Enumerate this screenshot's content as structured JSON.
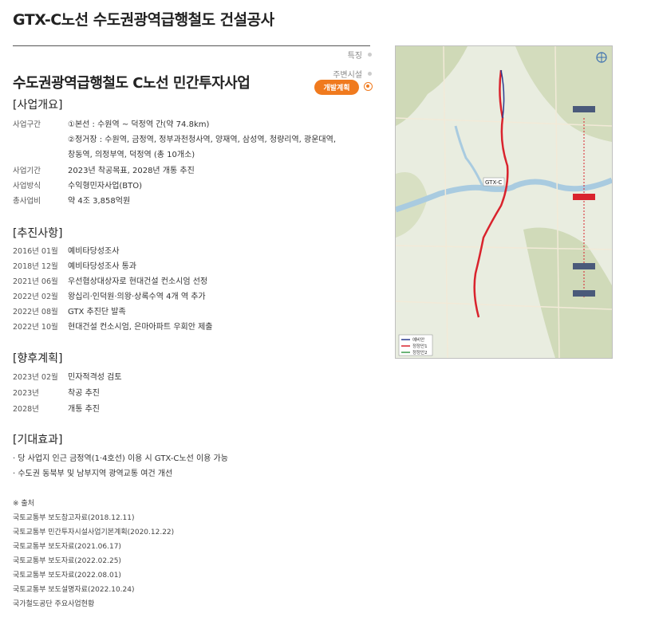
{
  "header": {
    "title": "GTX-C노선 수도권광역급행철도 건설공사"
  },
  "side_links": [
    {
      "label": "특징"
    },
    {
      "label": "주변시설"
    }
  ],
  "project": {
    "title": "수도권광역급행철도 C노선 민간투자사업",
    "dev_button": "개발계획"
  },
  "overview": {
    "heading": "[사업개요]",
    "rows": [
      {
        "key": "사업구간",
        "lines": [
          "①본선 : 수원역 ~ 덕정역 간(약 74.8km)",
          "②정거장 : 수원역, 금정역, 정부과천청사역, 양재역, 삼성역, 청량리역, 광운대역,",
          "창동역, 의정부역, 덕정역 (총 10개소)"
        ]
      },
      {
        "key": "사업기간",
        "lines": [
          "2023년 착공목표, 2028년 개통 추진"
        ]
      },
      {
        "key": "사업방식",
        "lines": [
          "수익형민자사업(BTO)"
        ]
      },
      {
        "key": "총사업비",
        "lines": [
          "약 4조 3,858억원"
        ]
      }
    ]
  },
  "progress": {
    "heading": "[추진사항]",
    "rows": [
      {
        "date": "2016년 01월",
        "text": "예비타당성조사"
      },
      {
        "date": "2018년 12월",
        "text": "예비타당성조사 통과"
      },
      {
        "date": "2021년 06월",
        "text": "우선협상대상자로 현대건설 컨소시엄 선정"
      },
      {
        "date": "2022년 02월",
        "text": "왕십리·인덕원·의왕·상록수역 4개 역 추가"
      },
      {
        "date": "2022년 08월",
        "text": "GTX 추진단 발족"
      },
      {
        "date": "2022년 10월",
        "text": "현대건설 컨소시엄, 은마아파트 우회안 제출"
      }
    ]
  },
  "future": {
    "heading": "[향후계획]",
    "rows": [
      {
        "date": "2023년 02월",
        "text": "민자적격성 검토"
      },
      {
        "date": "2023년",
        "text": "착공 추진"
      },
      {
        "date": "2028년",
        "text": "개통 추진"
      }
    ]
  },
  "effects": {
    "heading": "[기대효과]",
    "items": [
      "· 당 사업지 인근 금정역(1·4호선) 이용 시 GTX-C노선 이용 가능",
      "· 수도권 동북부 및 남부지역 광역교통 여건 개선"
    ]
  },
  "sources": {
    "heading": "※ 출처",
    "items": [
      "국토교통부 보도참고자료(2018.12.11)",
      "국토교통부 민간투자시설사업기본계획(2020.12.22)",
      "국토교통부 보도자료(2021.06.17)",
      "국토교통부 보도자료(2022.02.25)",
      "국토교통부 보도자료(2022.08.01)",
      "국토교통부 보도설명자료(2022.10.24)",
      "국가철도공단 주요사업현황"
    ]
  },
  "map": {
    "labels": {
      "gtx_c": "GTX-C",
      "legend": [
        "예비안",
        "정정안1",
        "정정안2"
      ]
    },
    "colors": {
      "route": "#d9232d",
      "river": "#a9cbe0",
      "accent": "#f07a1e"
    }
  }
}
